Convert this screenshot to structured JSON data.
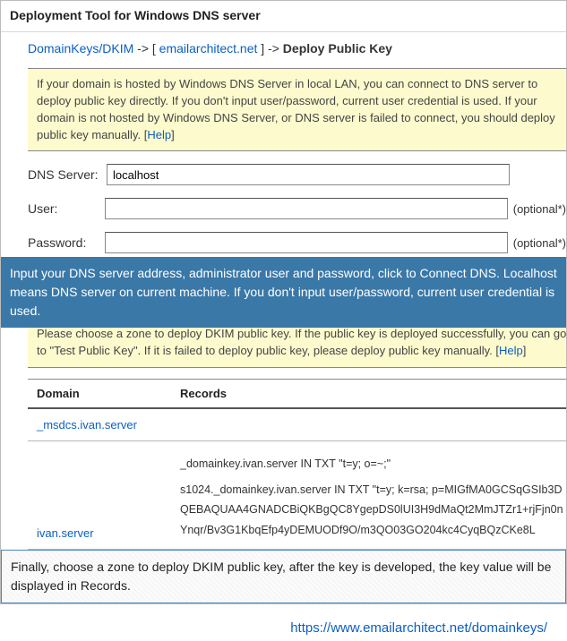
{
  "title": "Deployment Tool for Windows DNS server",
  "breadcrumb": {
    "a": "DomainKeys/DKIM",
    "sep1": " -> [ ",
    "b": "emailarchitect.net",
    "sep2": " ] -> ",
    "c": "Deploy Public Key"
  },
  "info1": {
    "text": "If your domain is hosted by Windows DNS Server in local LAN, you can connect to DNS server to deploy public key directly. If you don't input user/password, current user credential is used. If your domain is not hosted by Windows DNS Server, or DNS server is failed to connect, you should deploy public key manually. [",
    "help": "Help",
    "close": "]"
  },
  "form": {
    "dns_label": "DNS Server:",
    "dns_value": "localhost",
    "user_label": "User:",
    "user_value": "",
    "pass_label": "Password:",
    "pass_value": "",
    "optional": "(optional*)"
  },
  "callout_blue": "Input your DNS server address, administrator user and password, click to Connect DNS. Localhost means DNS server on current machine. If you don't input user/password, current user credential is used.",
  "info2": {
    "text": "Please choose a zone to deploy DKIM public key. If the public key is deployed successfully, you can go to \"Test Public Key\". If it is failed to deploy public key, please deploy public key manually. [",
    "help": "Help",
    "close": "]"
  },
  "table": {
    "h_domain": "Domain",
    "h_records": "Records",
    "rows": [
      {
        "domain": "_msdcs.ivan.server",
        "records": []
      },
      {
        "domain": "ivan.server",
        "records": [
          "_domainkey.ivan.server IN TXT \"t=y; o=~;\"",
          "s1024._domainkey.ivan.server IN TXT \"t=y; k=rsa; p=MIGfMA0GCSqGSIb3DQEBAQUAA4GNADCBiQKBgQC8YgepDS0lUI3H9dMaQt2MmJTZr1+rjFjn0nYnqr/Bv3G1KbqEfp4yDEMUODf9O/m3QO03GO204kc4CyqBQzCKe8L"
        ]
      }
    ]
  },
  "callout_outline": "Finally, choose a zone to deploy DKIM public key, after the key is developed, the key value will be displayed in Records.",
  "footer_url": "https://www.emailarchitect.net/domainkeys/"
}
